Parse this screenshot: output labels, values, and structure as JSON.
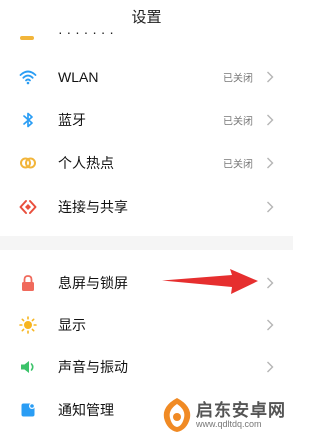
{
  "header": {
    "title": "设置"
  },
  "partial_row": {
    "label": "· · · · · · ·"
  },
  "items": [
    {
      "label": "WLAN",
      "status": "已关闭",
      "icon": "wifi-icon",
      "icon_color": "#2a9df4"
    },
    {
      "label": "蓝牙",
      "status": "已关闭",
      "icon": "bluetooth-icon",
      "icon_color": "#2a9df4"
    },
    {
      "label": "个人热点",
      "status": "已关闭",
      "icon": "hotspot-icon",
      "icon_color": "#f2b53a"
    },
    {
      "label": "连接与共享",
      "status": "",
      "icon": "connection-share-icon",
      "icon_color": "#e94f3d"
    },
    {
      "label": "息屏与锁屏",
      "status": "",
      "icon": "lock-icon",
      "icon_color": "#f06a5c"
    },
    {
      "label": "显示",
      "status": "",
      "icon": "brightness-icon",
      "icon_color": "#f7b520"
    },
    {
      "label": "声音与振动",
      "status": "",
      "icon": "volume-icon",
      "icon_color": "#3cc36a"
    },
    {
      "label": "通知管理",
      "status": "",
      "icon": "notification-icon",
      "icon_color": "#2a9df4"
    }
  ],
  "watermark": {
    "title": "启东安卓网",
    "url": "www.qdltdq.com"
  },
  "colors": {
    "chevron": "#b5b5b5",
    "annotation_arrow": "#e62f2f"
  }
}
